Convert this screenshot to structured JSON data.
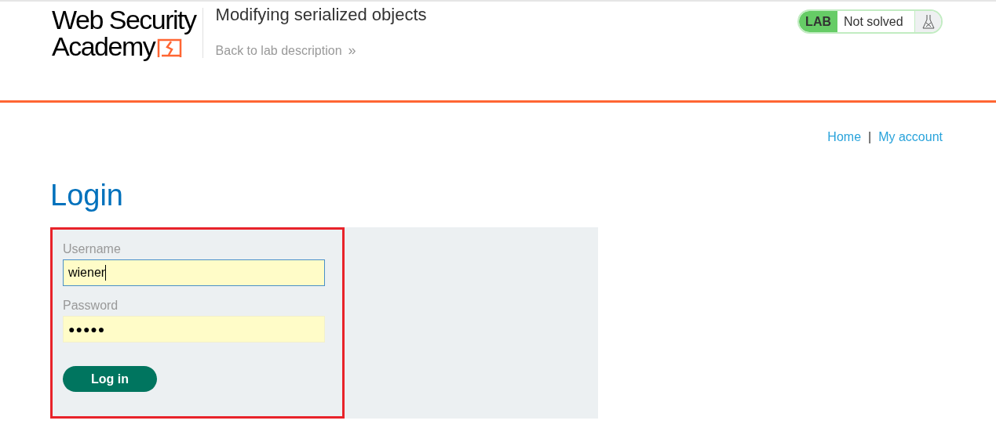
{
  "logo": {
    "line_1": "Web Security",
    "line_2": "Academy"
  },
  "lab": {
    "title": "Modifying serialized objects",
    "back_link": "Back to lab description",
    "back_link_icon": "»",
    "badge": "LAB",
    "status": "Not solved",
    "solved": false
  },
  "nav": {
    "links": [
      "Home",
      "My account"
    ],
    "separator": "|"
  },
  "page": {
    "heading": "Login"
  },
  "form": {
    "fields": [
      {
        "label": "Username",
        "value": "wiener",
        "focused": true
      },
      {
        "label": "Password",
        "value": "●●●●●",
        "focused": false
      }
    ],
    "submit": "Log in"
  }
}
